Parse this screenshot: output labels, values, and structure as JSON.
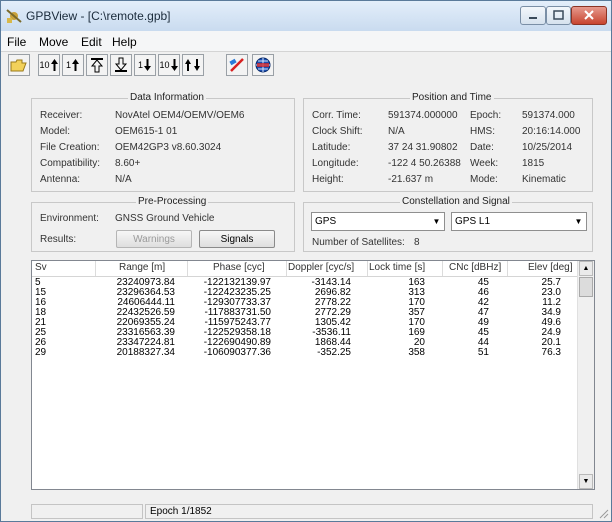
{
  "window": {
    "title": "GPBView - [C:\\remote.gpb]"
  },
  "menu": [
    "File",
    "Move",
    "Edit",
    "Help"
  ],
  "toolbar": {
    "buttons": [
      {
        "name": "open-file-button",
        "label": "",
        "icon": "folder-open-icon"
      },
      {
        "name": "back-10-button",
        "label": "10",
        "icon": "arrow-up-icon"
      },
      {
        "name": "back-1-button",
        "label": "1",
        "icon": "arrow-up-icon"
      },
      {
        "name": "first-epoch-button",
        "label": "",
        "icon": "arrow-top-icon"
      },
      {
        "name": "last-epoch-button",
        "label": "",
        "icon": "arrow-bottom-icon"
      },
      {
        "name": "forward-1-button",
        "label": "1",
        "icon": "arrow-down-icon"
      },
      {
        "name": "forward-10-button",
        "label": "10",
        "icon": "arrow-down-icon"
      },
      {
        "name": "goto-epoch-button",
        "label": "",
        "icon": "goto-icon"
      },
      {
        "name": "satellite-button",
        "label": "",
        "icon": "satellite-icon"
      },
      {
        "name": "globe-button",
        "label": "",
        "icon": "globe-icon"
      }
    ]
  },
  "data_information": {
    "title": "Data Information",
    "fields": [
      {
        "label": "Receiver:",
        "value": "NovAtel OEM4/OEMV/OEM6"
      },
      {
        "label": "Model:",
        "value": "OEM615-1 01"
      },
      {
        "label": "File Creation:",
        "value": "OEM42GP3 v8.60.3024"
      },
      {
        "label": "Compatibility:",
        "value": "8.60+"
      },
      {
        "label": "Antenna:",
        "value": "N/A"
      }
    ]
  },
  "position_time": {
    "title": "Position and Time",
    "left": [
      {
        "label": "Corr. Time:",
        "value": "591374.000000"
      },
      {
        "label": "Clock Shift:",
        "value": "N/A"
      },
      {
        "label": "Latitude:",
        "value": "37 24 31.90802"
      },
      {
        "label": "Longitude:",
        "value": "-122 4 50.26388"
      },
      {
        "label": "Height:",
        "value": "-21.637 m"
      }
    ],
    "right": [
      {
        "label": "Epoch:",
        "value": "591374.000"
      },
      {
        "label": "HMS:",
        "value": "20:16:14.000"
      },
      {
        "label": "Date:",
        "value": "10/25/2014"
      },
      {
        "label": "Week:",
        "value": "1815"
      },
      {
        "label": "Mode:",
        "value": "Kinematic"
      }
    ]
  },
  "pre_processing": {
    "title": "Pre-Processing",
    "environment_label": "Environment:",
    "environment_value": "GNSS Ground Vehicle",
    "results_label": "Results:",
    "warnings_label": "Warnings",
    "signals_label": "Signals"
  },
  "constellation": {
    "title": "Constellation and Signal",
    "constellation_value": "GPS",
    "signal_value": "GPS L1",
    "num_sats_label": "Number of Satellites:",
    "num_sats_value": "8"
  },
  "table": {
    "columns": [
      "Sv",
      "Range [m]",
      "Phase [cyc]",
      "Doppler [cyc/s]",
      "Lock time [s]",
      "CNc [dBHz]",
      "Elev [deg]"
    ],
    "rows": [
      [
        "5",
        "23240973.84",
        "-122132139.97",
        "-3143.14",
        "163",
        "45",
        "25.7"
      ],
      [
        "15",
        "23296364.53",
        "-122423235.25",
        "2696.82",
        "313",
        "46",
        "23.0"
      ],
      [
        "16",
        "24606444.11",
        "-129307733.37",
        "2778.22",
        "170",
        "42",
        "11.2"
      ],
      [
        "18",
        "22432526.59",
        "-117883731.50",
        "2772.29",
        "357",
        "47",
        "34.9"
      ],
      [
        "21",
        "22069355.24",
        "-115975243.77",
        "1305.42",
        "170",
        "49",
        "49.6"
      ],
      [
        "25",
        "23316563.39",
        "-122529358.18",
        "-3536.11",
        "169",
        "45",
        "24.9"
      ],
      [
        "26",
        "23347224.81",
        "-122690490.89",
        "1868.44",
        "20",
        "44",
        "20.1"
      ],
      [
        "29",
        "20188327.34",
        "-106090377.36",
        "-352.25",
        "358",
        "51",
        "76.3"
      ]
    ]
  },
  "status": {
    "epoch": "Epoch 1/1852"
  },
  "colors": {
    "titlebar": "#c9dbef",
    "close_button": "#c8452f",
    "window_bg": "#f0f0f0"
  }
}
